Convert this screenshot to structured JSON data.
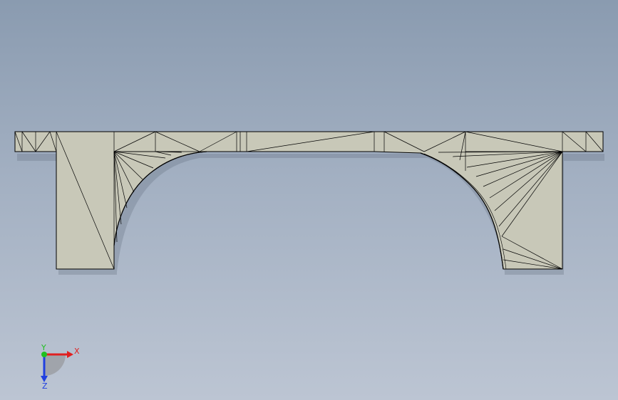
{
  "viewport": {
    "background_top": "#8a9bb0",
    "background_bottom": "#bcc5d3"
  },
  "model": {
    "face_color": "#c8c8b8",
    "edge_color": "#000000",
    "shadow_color": "#7a7a72"
  },
  "triad": {
    "x_label": "X",
    "y_label": "Y",
    "z_label": "Z",
    "x_color": "#e02020",
    "y_color": "#20c020",
    "z_color": "#2040e0"
  }
}
